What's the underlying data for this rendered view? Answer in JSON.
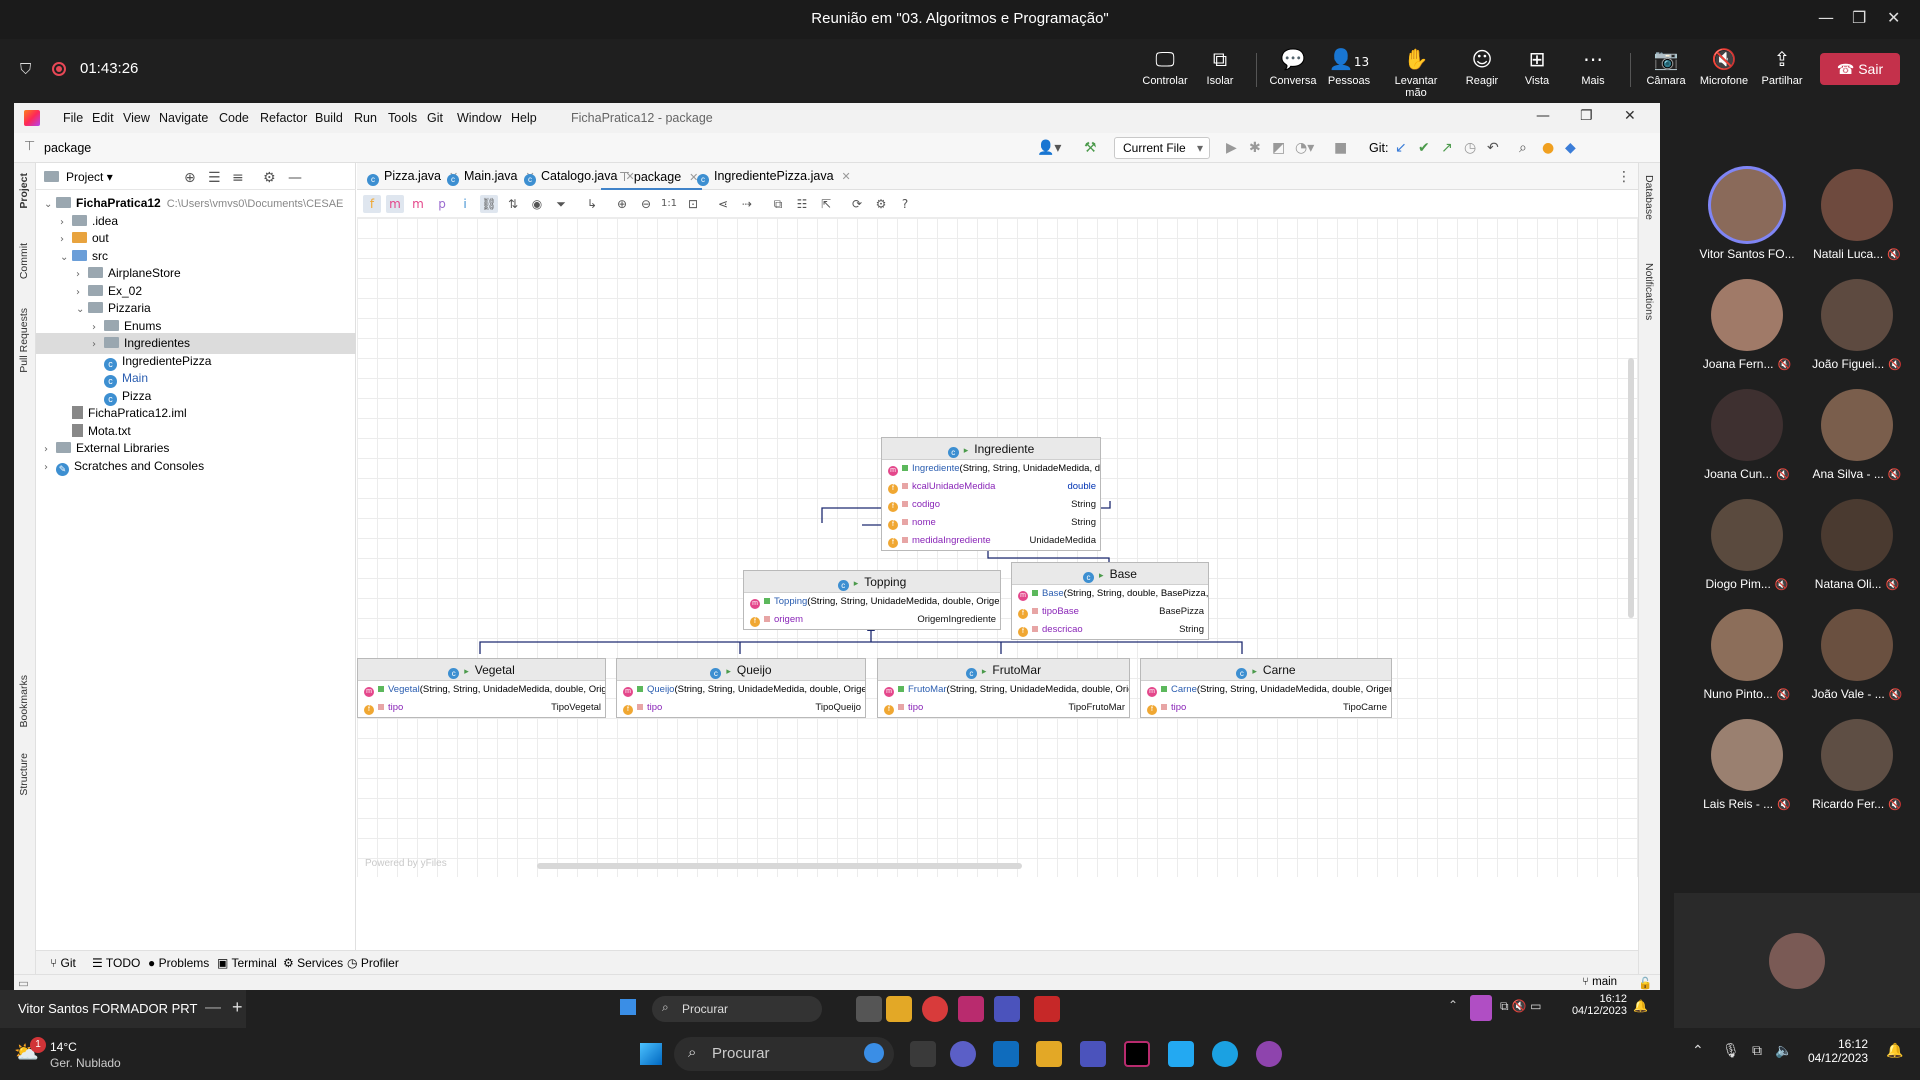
{
  "teams": {
    "window_title": "Reunião em \"03. Algoritmos e Programação\"",
    "timer": "01:43:26",
    "buttons": [
      {
        "label": "Controlar",
        "icon": "monitor-icon"
      },
      {
        "label": "Isolar",
        "icon": "isolate-icon"
      },
      {
        "label": "Conversa",
        "icon": "chat-icon"
      },
      {
        "label": "Pessoas",
        "icon": "people-icon",
        "count": "13"
      },
      {
        "label": "Levantar mão",
        "icon": "raise-hand-icon"
      },
      {
        "label": "Reagir",
        "icon": "react-icon"
      },
      {
        "label": "Vista",
        "icon": "view-icon"
      },
      {
        "label": "Mais",
        "icon": "more-icon"
      },
      {
        "label": "Câmara",
        "icon": "camera-off-icon"
      },
      {
        "label": "Microfone",
        "icon": "mic-off-icon"
      },
      {
        "label": "Partilhar",
        "icon": "share-icon"
      }
    ],
    "leave_label": "Sair",
    "participants": [
      "Vitor Santos FO...",
      "Natali Luca...",
      "Joana Fern...",
      "João Figuei...",
      "Joana Cun...",
      "Ana Silva - ...",
      "Diogo Pim...",
      "Natana Oli...",
      "Nuno Pinto...",
      "João Vale - ...",
      "Lais Reis - ...",
      "Ricardo Fer..."
    ]
  },
  "ide": {
    "menu": [
      "File",
      "Edit",
      "View",
      "Navigate",
      "Code",
      "Refactor",
      "Build",
      "Run",
      "Tools",
      "Git",
      "Window",
      "Help"
    ],
    "title": "FichaPratica12 - package",
    "breadcrumb": "package",
    "run_config": "Current File",
    "git_label": "Git:",
    "project_panel": {
      "title": "Project",
      "tree": [
        {
          "label": "FichaPratica12",
          "path": "C:\\Users\\vmvs0\\Documents\\CESAE",
          "depth": 0,
          "kind": "project",
          "expanded": true
        },
        {
          "label": ".idea",
          "depth": 1,
          "kind": "folder",
          "expanded": false
        },
        {
          "label": "out",
          "depth": 1,
          "kind": "folder-orange",
          "expanded": false
        },
        {
          "label": "src",
          "depth": 1,
          "kind": "folder-blue",
          "expanded": true
        },
        {
          "label": "AirplaneStore",
          "depth": 2,
          "kind": "package",
          "expanded": false
        },
        {
          "label": "Ex_02",
          "depth": 2,
          "kind": "package",
          "expanded": false
        },
        {
          "label": "Pizzaria",
          "depth": 2,
          "kind": "package",
          "expanded": true
        },
        {
          "label": "Enums",
          "depth": 3,
          "kind": "package",
          "expanded": false
        },
        {
          "label": "Ingredientes",
          "depth": 3,
          "kind": "package",
          "expanded": false,
          "selected": true
        },
        {
          "label": "IngredientePizza",
          "depth": 3,
          "kind": "class"
        },
        {
          "label": "Main",
          "depth": 3,
          "kind": "class"
        },
        {
          "label": "Pizza",
          "depth": 3,
          "kind": "class"
        },
        {
          "label": "FichaPratica12.iml",
          "depth": 1,
          "kind": "file"
        },
        {
          "label": "Mota.txt",
          "depth": 1,
          "kind": "file"
        },
        {
          "label": "External Libraries",
          "depth": 0,
          "kind": "libs",
          "expanded": false
        },
        {
          "label": "Scratches and Consoles",
          "depth": 0,
          "kind": "scratch",
          "expanded": false
        }
      ]
    },
    "tabs": [
      {
        "label": "Pizza.java",
        "active": false
      },
      {
        "label": "Main.java",
        "active": false
      },
      {
        "label": "Catalogo.java",
        "active": false
      },
      {
        "label": "package",
        "active": true
      },
      {
        "label": "IngredientePizza.java",
        "active": false
      }
    ],
    "left_stripe": [
      "Project",
      "Commit",
      "Pull Requests",
      "Bookmarks",
      "Structure"
    ],
    "right_stripe": [
      "Database",
      "Notifications"
    ],
    "bottom_tools": [
      "Git",
      "TODO",
      "Problems",
      "Terminal",
      "Services",
      "Profiler"
    ],
    "status_branch": "main",
    "powered_by": "Powered by yFiles"
  },
  "diagram": {
    "classes": {
      "ingrediente": {
        "name": "Ingrediente",
        "members": [
          {
            "kind": "m",
            "name": "Ingrediente",
            "sig": "(String, String, UnidadeMedida, double)",
            "type": ""
          },
          {
            "kind": "f",
            "name": "kcalUnidadeMedida",
            "type": "double"
          },
          {
            "kind": "f",
            "name": "codigo",
            "type": "String"
          },
          {
            "kind": "f",
            "name": "nome",
            "type": "String"
          },
          {
            "kind": "f",
            "name": "medidaIngrediente",
            "type": "UnidadeMedida"
          }
        ]
      },
      "topping": {
        "name": "Topping",
        "members": [
          {
            "kind": "m",
            "name": "Topping",
            "sig": "(String, String, UnidadeMedida, double, OrigemIngrediente)",
            "type": ""
          },
          {
            "kind": "f",
            "name": "origem",
            "type": "OrigemIngrediente"
          }
        ]
      },
      "base": {
        "name": "Base",
        "members": [
          {
            "kind": "m",
            "name": "Base",
            "sig": "(String, String, double, BasePizza, String)",
            "type": ""
          },
          {
            "kind": "f",
            "name": "tipoBase",
            "type": "BasePizza"
          },
          {
            "kind": "f",
            "name": "descricao",
            "type": "String"
          }
        ]
      },
      "vegetal": {
        "name": "Vegetal",
        "members": [
          {
            "kind": "m",
            "name": "Vegetal",
            "sig": "(String, String, UnidadeMedida, double, OrigemIngrediente, TipoVegetal)",
            "type": ""
          },
          {
            "kind": "f",
            "name": "tipo",
            "type": "TipoVegetal"
          }
        ]
      },
      "queijo": {
        "name": "Queijo",
        "members": [
          {
            "kind": "m",
            "name": "Queijo",
            "sig": "(String, String, UnidadeMedida, double, OrigemIngrediente, TipoQueijo)",
            "type": ""
          },
          {
            "kind": "f",
            "name": "tipo",
            "type": "TipoQueijo"
          }
        ]
      },
      "frutomar": {
        "name": "FrutoMar",
        "members": [
          {
            "kind": "m",
            "name": "FrutoMar",
            "sig": "(String, String, UnidadeMedida, double, OrigemIngrediente, TipoFrutoMar)",
            "type": ""
          },
          {
            "kind": "f",
            "name": "tipo",
            "type": "TipoFrutoMar"
          }
        ]
      },
      "carne": {
        "name": "Carne",
        "members": [
          {
            "kind": "m",
            "name": "Carne",
            "sig": "(String, String, UnidadeMedida, double, OrigemIngrediente, TipoCarne)",
            "type": ""
          },
          {
            "kind": "f",
            "name": "tipo",
            "type": "TipoCarne"
          }
        ]
      }
    }
  },
  "inner_taskbar": {
    "presenter": "Vitor Santos FORMADOR PRT",
    "search": "Procurar",
    "time": "16:12",
    "date": "04/12/2023"
  },
  "taskbar": {
    "weather_temp": "14°C",
    "weather_desc": "Ger. Nublado",
    "notification_count": "1",
    "search": "Procurar",
    "time": "16:12",
    "date": "04/12/2023"
  }
}
